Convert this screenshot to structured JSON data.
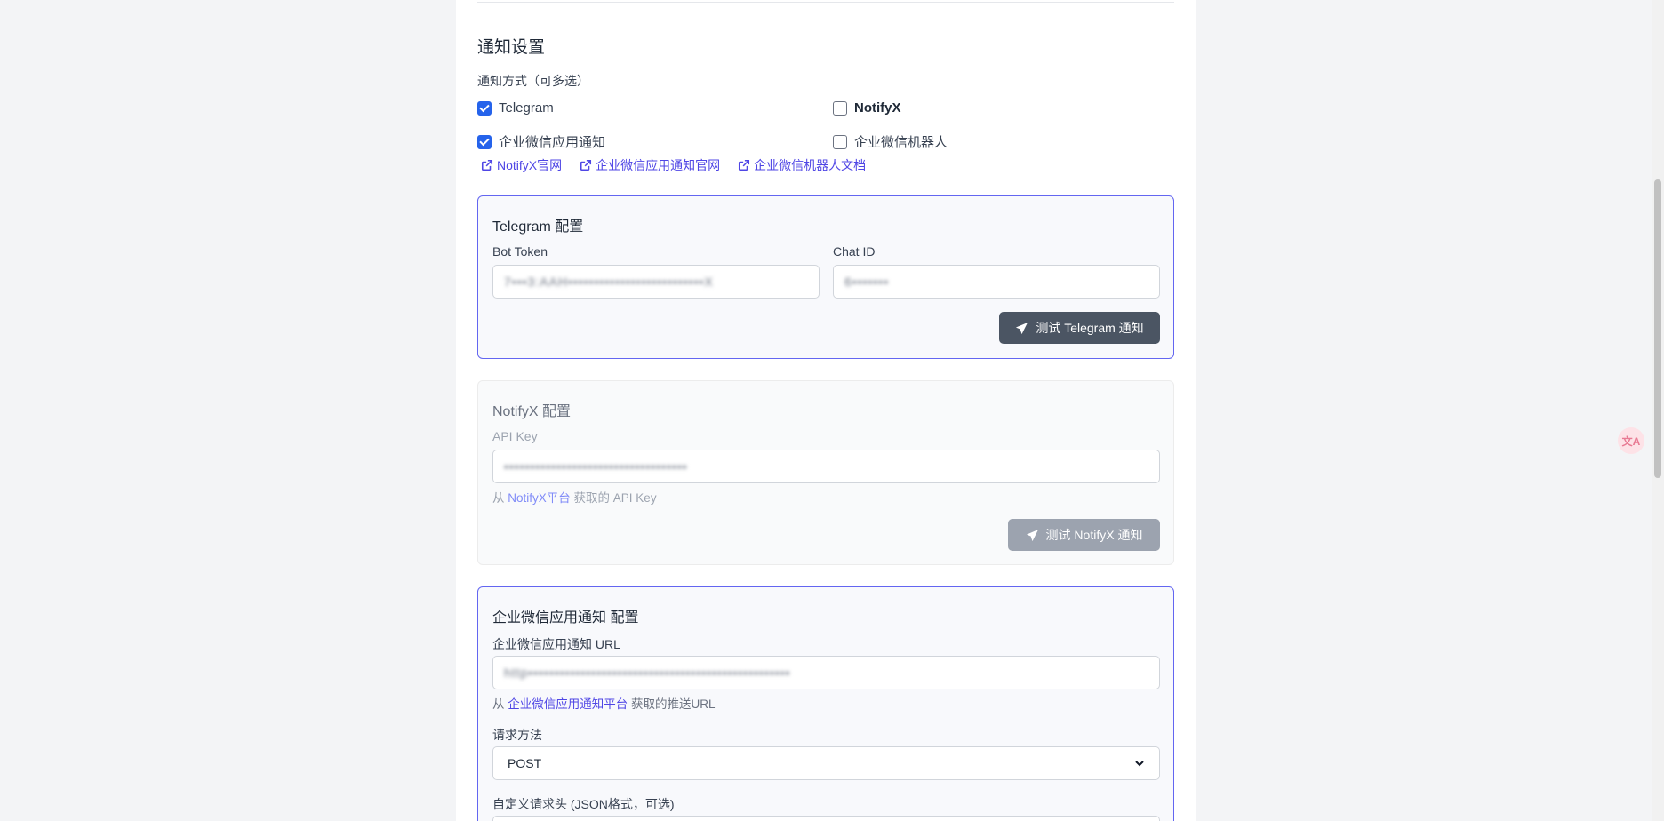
{
  "notifications": {
    "title": "通知设置",
    "methods_label": "通知方式（可多选）",
    "options": [
      {
        "label": "Telegram",
        "checked": true
      },
      {
        "label": "NotifyX",
        "checked": false
      },
      {
        "label": "企业微信应用通知",
        "checked": true
      },
      {
        "label": "企业微信机器人",
        "checked": false
      }
    ],
    "links": [
      {
        "label": "NotifyX官网"
      },
      {
        "label": "企业微信应用通知官网"
      },
      {
        "label": "企业微信机器人文档"
      }
    ]
  },
  "telegram": {
    "title": "Telegram 配置",
    "bot_token_label": "Bot Token",
    "bot_token_value": "7•••3:AAH••••••••••••••••••••••••••X",
    "chat_id_label": "Chat ID",
    "chat_id_value": "6•••••••",
    "test_button": "测试 Telegram 通知"
  },
  "notifyx": {
    "title": "NotifyX 配置",
    "api_key_label": "API Key",
    "api_key_value": "•••••••••••••••••••••••••••••••••••",
    "help_prefix": "从",
    "help_link": "NotifyX平台",
    "help_suffix": "获取的 API Key",
    "test_button": "测试 NotifyX 通知"
  },
  "wechat_app": {
    "title": "企业微信应用通知 配置",
    "url_label": "企业微信应用通知 URL",
    "url_value": "http••••••••••••••••••••••••••••••••••••••••••••••••••",
    "help_prefix": "从",
    "help_link": "企业微信应用通知平台",
    "help_suffix": "获取的推送URL",
    "method_label": "请求方法",
    "method_value": "POST",
    "headers_label": "自定义请求头 (JSON格式，可选)"
  },
  "floating": {
    "label": "文A"
  },
  "colors": {
    "accent": "#4f46e5",
    "checkbox": "#2563eb",
    "card_border": "#6366f1"
  }
}
